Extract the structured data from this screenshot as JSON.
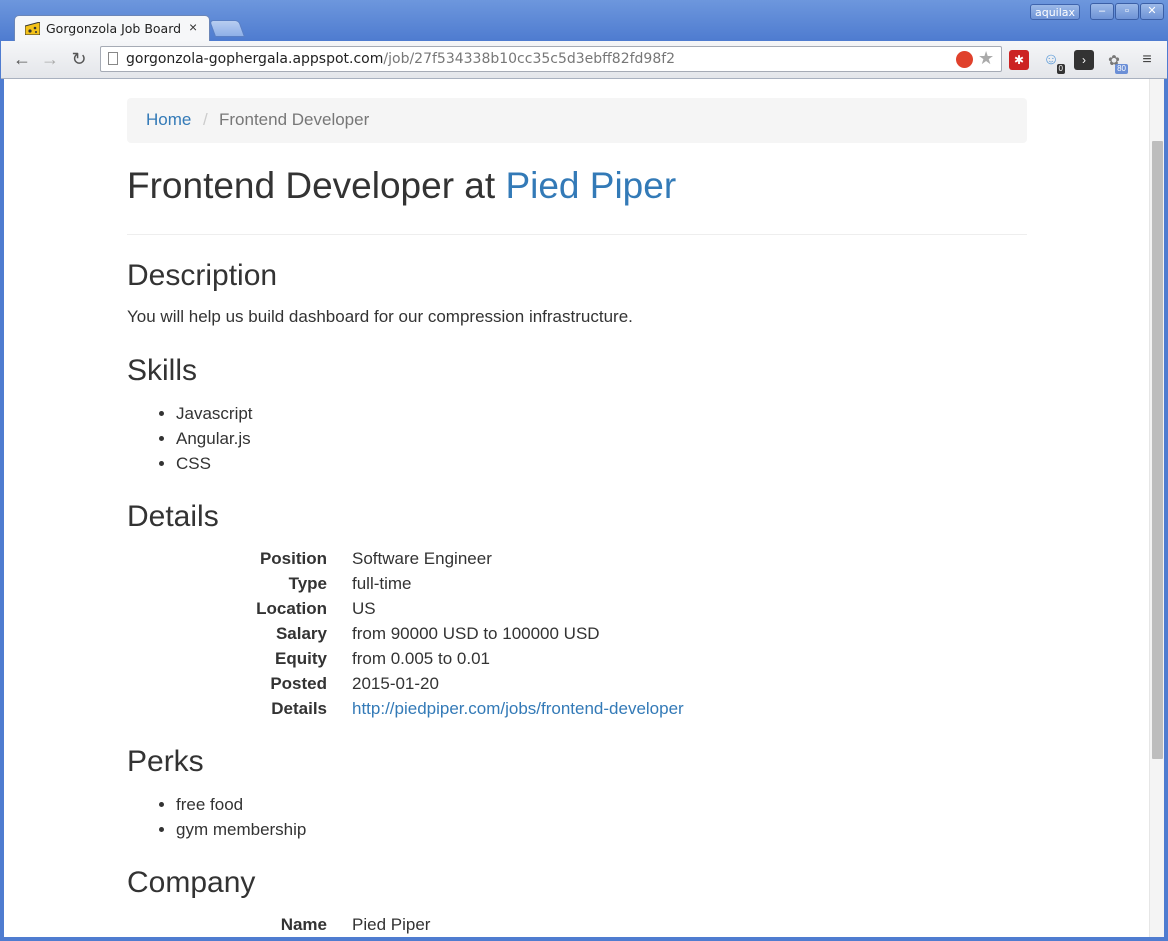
{
  "browser": {
    "tab_title": "Gorgonzola Job Board",
    "tab_close": "×",
    "user": "aquilax",
    "url_host": "gorgonzola-gophergala.appspot.com",
    "url_path": "/job/27f534338b10cc35c5d3ebff82fd98f2",
    "ext_ghost_badge": "0",
    "ext_bee_badge": "80"
  },
  "breadcrumb": {
    "home": "Home",
    "separator": "/",
    "current": "Frontend Developer"
  },
  "job": {
    "title_prefix": "Frontend Developer at ",
    "company_link": "Pied Piper"
  },
  "description": {
    "heading": "Description",
    "text": "You will help us build dashboard for our compression infrastructure."
  },
  "skills": {
    "heading": "Skills",
    "items": [
      "Javascript",
      "Angular.js",
      "CSS"
    ]
  },
  "details": {
    "heading": "Details",
    "rows": [
      {
        "label": "Position",
        "value": "Software Engineer"
      },
      {
        "label": "Type",
        "value": "full-time"
      },
      {
        "label": "Location",
        "value": "US"
      },
      {
        "label": "Salary",
        "value": "from 90000 USD to 100000 USD"
      },
      {
        "label": "Equity",
        "value": "from 0.005 to 0.01"
      },
      {
        "label": "Posted",
        "value": "2015-01-20"
      },
      {
        "label": "Details",
        "value": "http://piedpiper.com/jobs/frontend-developer"
      }
    ]
  },
  "perks": {
    "heading": "Perks",
    "items": [
      "free food",
      "gym membership"
    ]
  },
  "company": {
    "heading": "Company",
    "rows": [
      {
        "label": "Name",
        "value": "Pied Piper"
      }
    ]
  }
}
